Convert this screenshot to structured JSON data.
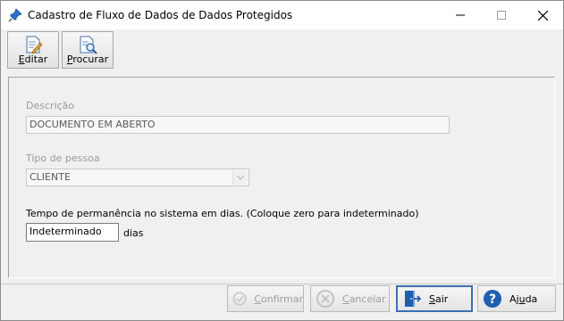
{
  "window": {
    "title": "Cadastro de Fluxo de Dados de Dados Protegidos"
  },
  "toolbar": {
    "edit": {
      "mnemonic": "E",
      "rest": "ditar"
    },
    "search": {
      "mnemonic": "P",
      "rest": "rocurar"
    }
  },
  "form": {
    "description": {
      "label": "Descrição",
      "value": "DOCUMENTO EM ABERTO"
    },
    "person_type": {
      "label": "Tipo de pessoa",
      "value": "CLIENTE"
    },
    "retention": {
      "label": "Tempo de permanência no sistema em dias. (Coloque zero para indeterminado)",
      "value": "Indeterminado",
      "unit": "dias"
    }
  },
  "actions": {
    "confirm": {
      "mnemonic": "C",
      "rest": "onfirmar",
      "enabled": false
    },
    "cancel": {
      "mnemonic": "C",
      "rest": "ancelar",
      "enabled": false
    },
    "exit": {
      "mnemonic": "S",
      "rest": "air",
      "enabled": true
    },
    "help": {
      "prefix": "Aj",
      "mnemonic": "u",
      "rest": "da",
      "enabled": true
    }
  },
  "colors": {
    "help_blue": "#1f5fb0",
    "exit_border": "#3c6fb2",
    "disabled_text": "#a0a0a0"
  },
  "icons": [
    "pin-icon",
    "minimize-icon",
    "maximize-icon",
    "close-icon",
    "edit-document-icon",
    "search-document-icon",
    "chevron-down-icon",
    "check-circle-icon",
    "x-circle-icon",
    "exit-door-icon",
    "help-icon"
  ]
}
